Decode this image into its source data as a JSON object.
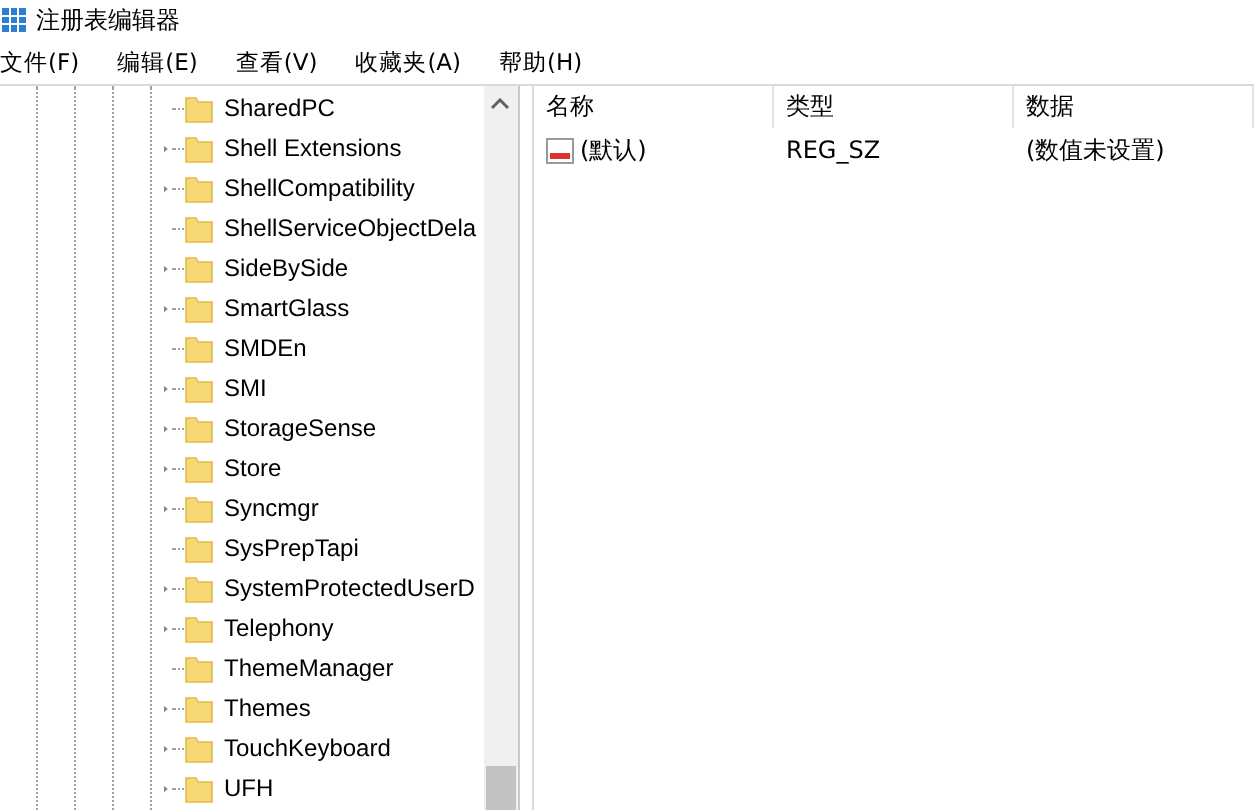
{
  "window": {
    "title": "注册表编辑器"
  },
  "menu": [
    "文件(F)",
    "编辑(E)",
    "查看(V)",
    "收藏夹(A)",
    "帮助(H)"
  ],
  "tree": {
    "items": [
      {
        "label": "SharedPC",
        "expandable": false
      },
      {
        "label": "Shell Extensions",
        "expandable": true
      },
      {
        "label": "ShellCompatibility",
        "expandable": true
      },
      {
        "label": "ShellServiceObjectDela",
        "expandable": false
      },
      {
        "label": "SideBySide",
        "expandable": true
      },
      {
        "label": "SmartGlass",
        "expandable": true
      },
      {
        "label": "SMDEn",
        "expandable": false
      },
      {
        "label": "SMI",
        "expandable": true
      },
      {
        "label": "StorageSense",
        "expandable": true
      },
      {
        "label": "Store",
        "expandable": true
      },
      {
        "label": "Syncmgr",
        "expandable": true
      },
      {
        "label": "SysPrepTapi",
        "expandable": false
      },
      {
        "label": "SystemProtectedUserD",
        "expandable": true
      },
      {
        "label": "Telephony",
        "expandable": true
      },
      {
        "label": "ThemeManager",
        "expandable": false
      },
      {
        "label": "Themes",
        "expandable": true
      },
      {
        "label": "TouchKeyboard",
        "expandable": true
      },
      {
        "label": "UFH",
        "expandable": true
      }
    ]
  },
  "values": {
    "columns": [
      "名称",
      "类型",
      "数据"
    ],
    "rows": [
      {
        "name": "(默认)",
        "type": "REG_SZ",
        "data": "(数值未设置)"
      }
    ]
  }
}
